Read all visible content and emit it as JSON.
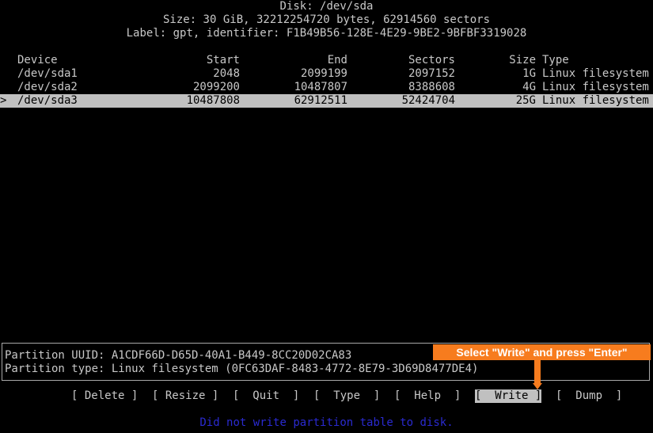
{
  "disk": {
    "title": "Disk: /dev/sda",
    "size_line": "Size: 30 GiB, 32212254720 bytes, 62914560 sectors",
    "label_line": "Label: gpt, identifier: F1B49B56-128E-4E29-9BE2-9BFBF3319028"
  },
  "table": {
    "headers": {
      "device": "Device",
      "start": "Start",
      "end": "End",
      "sectors": "Sectors",
      "size": "Size",
      "type": "Type"
    },
    "rows": [
      {
        "device": "/dev/sda1",
        "start": "2048",
        "end": "2099199",
        "sectors": "2097152",
        "size": "1G",
        "type": "Linux filesystem"
      },
      {
        "device": "/dev/sda2",
        "start": "2099200",
        "end": "10487807",
        "sectors": "8388608",
        "size": "4G",
        "type": "Linux filesystem"
      },
      {
        "device": "/dev/sda3",
        "start": "10487808",
        "end": "62912511",
        "sectors": "52424704",
        "size": "25G",
        "type": "Linux filesystem"
      }
    ],
    "cursor": ">"
  },
  "info": {
    "uuid_line": "Partition UUID: A1CDF66D-D65D-40A1-B449-8CC20D02CA83",
    "type_line": "Partition type: Linux filesystem (0FC63DAF-8483-4772-8E79-3D69D8477DE4)"
  },
  "menu": {
    "delete": "[ Delete ]",
    "resize": "[ Resize ]",
    "quit": "[  Quit  ]",
    "type": "[  Type  ]",
    "help": "[  Help  ]",
    "write": "[  Write ]",
    "dump": "[  Dump  ]"
  },
  "status": "Did not write partition table to disk.",
  "callout": "Select \"Write\" and press \"Enter\"",
  "colors": {
    "callout": "#f77c1e",
    "status": "#2a2ad0",
    "highlight": "#c0c0c0"
  }
}
